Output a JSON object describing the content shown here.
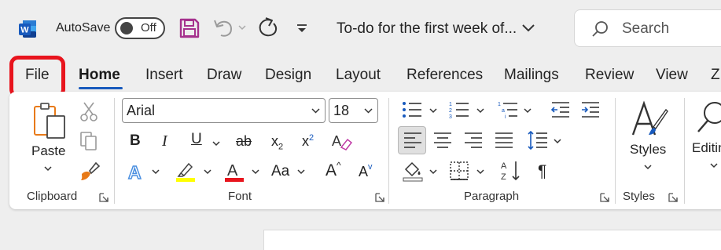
{
  "titlebar": {
    "app_icon": "word-logo-icon",
    "autosave_label": "AutoSave",
    "toggle_state": "Off",
    "document_title": "To-do for the first week of...",
    "search_placeholder": "Search"
  },
  "tabs": [
    {
      "label": "File"
    },
    {
      "label": "Home",
      "active": true
    },
    {
      "label": "Insert"
    },
    {
      "label": "Draw"
    },
    {
      "label": "Design"
    },
    {
      "label": "Layout"
    },
    {
      "label": "References"
    },
    {
      "label": "Mailings"
    },
    {
      "label": "Review"
    },
    {
      "label": "View"
    },
    {
      "label": "Z"
    }
  ],
  "ribbon": {
    "clipboard": {
      "label": "Clipboard",
      "paste_label": "Paste"
    },
    "font": {
      "label": "Font",
      "font_name": "Arial",
      "font_size": "18",
      "bold": "B",
      "italic": "I",
      "underline": "U",
      "strikethrough": "ab",
      "subscript": "x",
      "subscript_mark": "2",
      "superscript": "x",
      "superscript_mark": "2",
      "text_effects": "A",
      "font_color": "A",
      "change_case": "Aa",
      "grow_font": "A",
      "shrink_font": "A"
    },
    "paragraph": {
      "label": "Paragraph",
      "show_formatting": "¶"
    },
    "styles": {
      "label": "Styles",
      "button_label": "Styles"
    },
    "editing": {
      "button_label": "Editing"
    }
  },
  "colors": {
    "accent": "#185abd",
    "highlight": "#e8141d",
    "word_blue": "#185abd",
    "save_purple": "#a5318d",
    "highlighter_yellow": "#ffff00",
    "font_color_red": "#e8141d",
    "text_effect_blue": "#4a8fe0",
    "brush_orange": "#e87a18"
  }
}
